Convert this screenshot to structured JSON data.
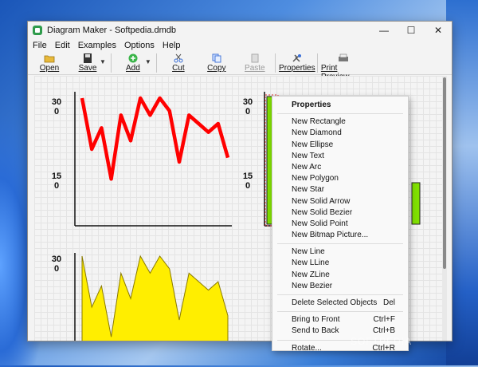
{
  "window": {
    "title": "Diagram Maker - Softpedia.dmdb",
    "controls": {
      "minimize": "—",
      "maximize": "☐",
      "close": "✕"
    }
  },
  "menu": [
    "File",
    "Edit",
    "Examples",
    "Options",
    "Help"
  ],
  "toolbar": {
    "open": "Open",
    "save": "Save",
    "add": "Add",
    "cut": "Cut",
    "copy": "Copy",
    "paste": "Paste",
    "properties": "Properties",
    "print_preview": "Print Preview"
  },
  "charts": {
    "line": {
      "y_top": "30\n0",
      "y_mid": "15\n0",
      "color": "#ff0000",
      "values": [
        300,
        180,
        230,
        110,
        260,
        200,
        300,
        260,
        300,
        270,
        150,
        260,
        240,
        220,
        240,
        160
      ]
    },
    "bar": {
      "y_top": "30\n0",
      "y_mid": "15\n0",
      "color": "#80e000"
    },
    "area": {
      "y_top": "30\n0",
      "color": "#ffee00",
      "values": [
        300,
        180,
        230,
        110,
        260,
        200,
        300,
        260,
        300,
        270,
        150,
        260,
        240,
        220,
        240,
        160
      ]
    }
  },
  "context_menu": {
    "header": "Properties",
    "new_items": [
      "New Rectangle",
      "New Diamond",
      "New Ellipse",
      "New Text",
      "New Arc",
      "New Polygon",
      "New Star",
      "New Solid Arrow",
      "New Solid Bezier",
      "New Solid Point",
      "New Bitmap Picture..."
    ],
    "line_items": [
      "New Line",
      "New LLine",
      "New ZLine",
      "New Bezier"
    ],
    "delete": {
      "label": "Delete Selected Objects",
      "shortcut": "Del"
    },
    "bring_front": {
      "label": "Bring to Front",
      "shortcut": "Ctrl+F"
    },
    "send_back": {
      "label": "Send to Back",
      "shortcut": "Ctrl+B"
    },
    "rotate": {
      "label": "Rotate...",
      "shortcut": "Ctrl+R"
    }
  },
  "watermark": "SOFTPEDIA"
}
